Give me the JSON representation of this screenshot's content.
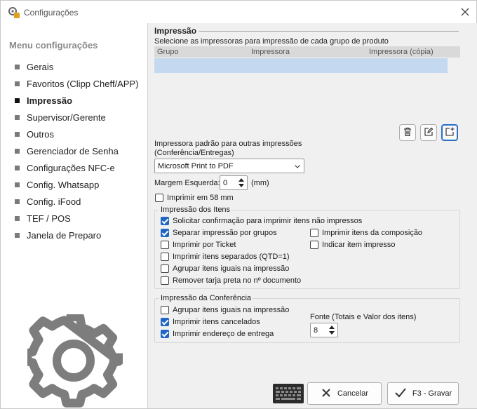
{
  "window": {
    "title": "Configurações"
  },
  "sidebar": {
    "title": "Menu configurações",
    "items": [
      {
        "label": "Gerais"
      },
      {
        "label": "Favoritos (Clipp Cheff/APP)"
      },
      {
        "label": "Impressão"
      },
      {
        "label": "Supervisor/Gerente"
      },
      {
        "label": "Outros"
      },
      {
        "label": "Gerenciador de Senha"
      },
      {
        "label": "Configurações NFC-e"
      },
      {
        "label": "Config. Whatsapp"
      },
      {
        "label": "Config. iFood"
      },
      {
        "label": "TEF / POS"
      },
      {
        "label": "Janela de Preparo"
      }
    ],
    "active_index": 2
  },
  "printing": {
    "title": "Impressão",
    "description": "Selecione as impressoras para impressão de cada grupo de produto",
    "columns": [
      "Grupo",
      "Impressora",
      "Impressora (cópia)"
    ]
  },
  "default_printer": {
    "label_line1": "Impressora padrão para outras impressões",
    "label_line2": "(Conferência/Entregas)",
    "value": "Microsoft Print to PDF"
  },
  "left_margin": {
    "label": "Margem Esquerda:",
    "value": "0",
    "unit": "(mm)"
  },
  "print_58mm": {
    "label": "Imprimir em 58 mm",
    "checked": false
  },
  "items_group": {
    "title": "Impressão dos Itens",
    "options": [
      {
        "label": "Solicitar confirmação para imprimir itens não impressos",
        "checked": true
      },
      {
        "label": "Separar impressão por grupos",
        "checked": true
      },
      {
        "label": "Imprimir por Ticket",
        "checked": false
      },
      {
        "label": "Imprimir itens separados (QTD=1)",
        "checked": false
      },
      {
        "label": "Agrupar itens iguais na impressão",
        "checked": false
      },
      {
        "label": "Remover tarja preta no nº documento",
        "checked": false
      },
      {
        "label": "Imprimir itens da composição",
        "checked": false
      },
      {
        "label": "Indicar item impresso",
        "checked": false
      }
    ]
  },
  "conference_group": {
    "title": "Impressão da Conferência",
    "options": [
      {
        "label": "Agrupar itens iguais na impressão",
        "checked": false
      },
      {
        "label": "Imprimir itens cancelados",
        "checked": true
      },
      {
        "label": "Imprimir endereço de entrega",
        "checked": true
      }
    ],
    "font_label": "Fonte (Totais e Valor dos itens)",
    "font_value": "8"
  },
  "footer": {
    "cancel_label": "Cancelar",
    "save_label": "F3 - Gravar"
  },
  "colors": {
    "accent": "#1f66c4",
    "selected_row": "#c4d8ef"
  }
}
